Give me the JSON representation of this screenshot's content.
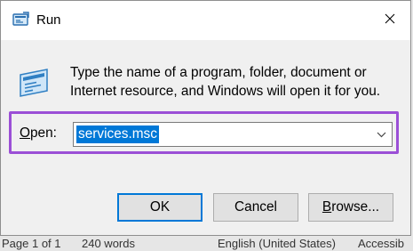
{
  "window": {
    "title": "Run",
    "close_glyph": "✕"
  },
  "description": "Type the name of a program, folder, document or Internet resource, and Windows will open it for you.",
  "open_field": {
    "label_prefix": "O",
    "label_rest": "pen:",
    "value": "services.msc"
  },
  "buttons": {
    "ok": "OK",
    "cancel": "Cancel",
    "browse_prefix": "B",
    "browse_rest": "rowse..."
  },
  "statusbar": {
    "page": "Page 1 of 1",
    "words": "240 words",
    "language": "English (United States)",
    "accessibility": "Accessib"
  },
  "colors": {
    "accent": "#0078d7",
    "highlight": "#9b4fd6"
  }
}
